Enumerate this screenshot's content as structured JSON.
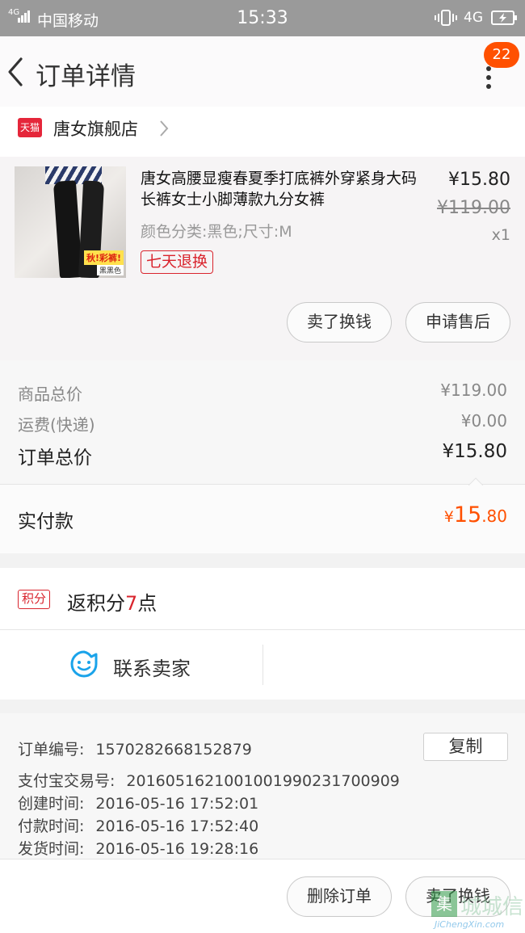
{
  "status_bar": {
    "network_type": "4G",
    "carrier": "中国移动",
    "time": "15:33",
    "net_right": "4G"
  },
  "nav": {
    "title": "订单详情",
    "badge": "22"
  },
  "shop": {
    "platform_mark": "天猫",
    "name": "唐女旗舰店"
  },
  "item": {
    "title": "唐女高腰显瘦春夏季打底裤外穿紧身大码长裤女士小脚薄款九分女裤",
    "sku": "颜色分类:黑色;尺寸:M",
    "service_tag": "七天退换",
    "price": "¥15.80",
    "original_price": "¥119.00",
    "quantity": "x1",
    "thumb_tag_1": "秋!彩裤!",
    "thumb_tag_2": "黑黑色",
    "buttons": [
      "卖了换钱",
      "申请售后"
    ]
  },
  "summary": {
    "goods_total_label": "商品总价",
    "goods_total": "¥119.00",
    "shipping_label": "运费(快递)",
    "shipping": "¥0.00",
    "order_total_label": "订单总价",
    "order_total": "¥15.80",
    "paid_label": "实付款",
    "paid_currency": "¥",
    "paid_integer": "15",
    "paid_decimal": ".80"
  },
  "points": {
    "tag": "积分",
    "prefix": "返积分",
    "count": "7",
    "suffix": "点"
  },
  "contact": {
    "label": "联系卖家"
  },
  "order_info": {
    "rows": [
      {
        "key": "订单编号:",
        "value": "1570282668152879"
      },
      {
        "key": "支付宝交易号:",
        "value": "2016051621001001990231700909"
      },
      {
        "key": "创建时间:",
        "value": "2016-05-16 17:52:01"
      },
      {
        "key": "付款时间:",
        "value": "2016-05-16 17:52:40"
      },
      {
        "key": "发货时间:",
        "value": "2016-05-16 19:28:16"
      }
    ],
    "copy_label": "复制"
  },
  "footer": {
    "buttons": [
      "删除订单",
      "卖了换钱"
    ]
  },
  "watermark": {
    "mark": "集",
    "text": "城城信",
    "url": "JiChengXin.com"
  },
  "colors": {
    "accent": "#ff5000",
    "red": "#d9242d",
    "tmall": "#e5263a",
    "contact_blue": "#1aa3ea"
  }
}
